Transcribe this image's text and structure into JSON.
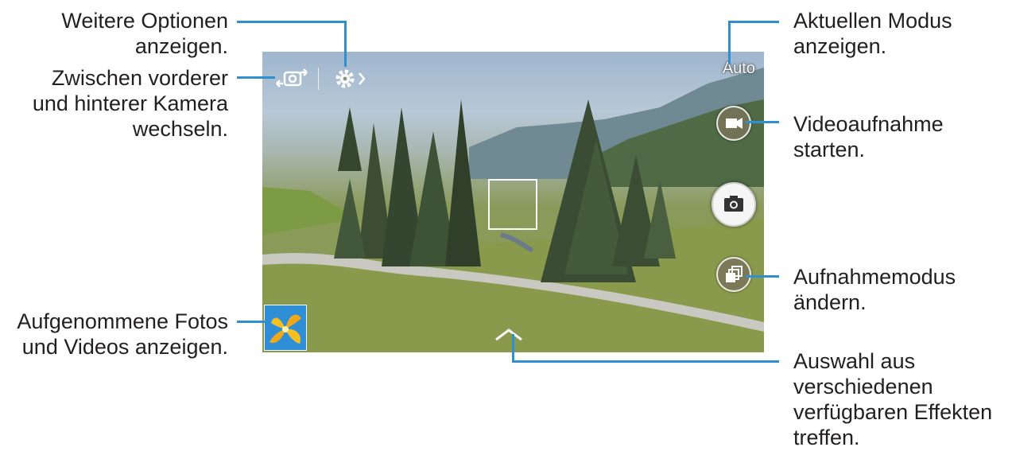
{
  "viewfinder": {
    "mode_label": "Auto"
  },
  "callouts": {
    "more_options": [
      "Weitere Optionen",
      "anzeigen."
    ],
    "switch_camera": [
      "Zwischen vorderer",
      "und hinterer Kamera",
      "wechseln."
    ],
    "gallery": [
      "Aufgenommene Fotos",
      "und Videos anzeigen."
    ],
    "current_mode": [
      "Aktuellen Modus",
      "anzeigen."
    ],
    "video_record": [
      "Videoaufnahme",
      "starten."
    ],
    "shooting_mode": [
      "Aufnahmemodus",
      "ändern."
    ],
    "effects": [
      "Auswahl aus",
      "verschiedenen",
      "verfügbaren Effekten",
      "treffen."
    ]
  },
  "icons": {
    "switch_camera": "camera-switch-icon",
    "settings": "gear-icon",
    "video": "video-camera-icon",
    "shutter": "camera-icon",
    "mode": "stacked-squares-icon",
    "effects": "chevron-up-icon",
    "gallery": "gallery-thumbnail-icon"
  },
  "colors": {
    "callout_line": "#2f8fcf"
  }
}
